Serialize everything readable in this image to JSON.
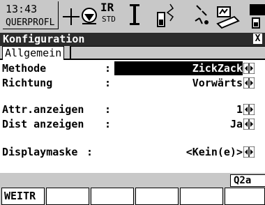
{
  "status": {
    "time": "13:43",
    "job": "QUERPROFL",
    "ir": "IR",
    "std": "STD"
  },
  "title": "Konfiguration",
  "close_label": "X",
  "tab": "Allgemein",
  "fields": [
    {
      "label": "Methode",
      "colon": ":",
      "value": "ZickZack",
      "highlighted": true
    },
    {
      "label": "Richtung",
      "colon": ":",
      "value": "Vorwärts"
    },
    {
      "label": "Attr.anzeigen",
      "colon": ":",
      "value": "1"
    },
    {
      "label": "Dist anzeigen",
      "colon": ":",
      "value": "Ja"
    },
    {
      "label": "Displaymaske",
      "colon": " :",
      "value": "<Kein(e)>"
    }
  ],
  "qcode": "Q2a",
  "softkeys": [
    "WEITR",
    "",
    "",
    "",
    "",
    ""
  ]
}
